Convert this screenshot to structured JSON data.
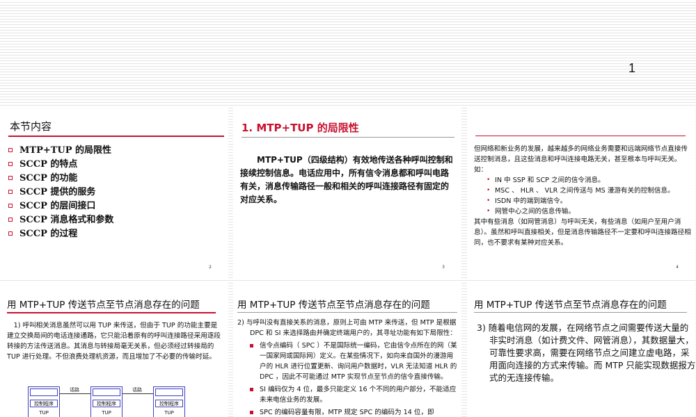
{
  "top_page_number": "1",
  "s2": {
    "title": "本节内容",
    "items": [
      "MTP+TUP 的局限性",
      "SCCP 的特点",
      "SCCP 的功能",
      "SCCP 提供的服务",
      "SCCP 的层间接口",
      "SCCP 消息格式和参数",
      "SCCP 的过程"
    ],
    "page": "2"
  },
  "s3": {
    "title": "1. MTP+TUP 的局限性",
    "body": "MTP+TUP（四级结构）有效地传送各种呼叫控制和接续控制信息。电话应用中，所有信令消息都和呼叫电路有关，消息传输路径一般和相关的呼叫连接路径有固定的对应关系。",
    "page": "3"
  },
  "s4": {
    "intro": "但网络和新业务的发展，越来越多的网络业务需要和远端网络节点直接传送控制消息，且这些消息和呼叫连接电路无关，甚至根本与呼叫无关。如：",
    "bullets": [
      "IN 中 SSP 和 SCP 之间的信令消息。",
      "MSC 、 HLR 、 VLR 之间传送与 MS 漫游有关的控制信息。",
      "ISDN 中的端到端信令。",
      "网管中心之间的信息传输。"
    ],
    "outro": "其中有些消息（如网管消息）与呼叫无关，有些消息（如用户至用户消息）。虽然和呼叫直接相关，但是消息传输路径不一定要和呼叫连接路径相同，也不要求有某种对应关系。",
    "page": "4"
  },
  "s5": {
    "title": "用 MTP+TUP 传送节点至节点消息存在的问题",
    "body": "1) 呼叫相关消息虽然可以用 TUP 来传送，但由于 TUP 的功能主要是建立交换局间的电话连接通路，它只能沿着原有的呼叫连接路径采用逐段转接的方法传送消息。其消息与转接局毫无关系，但必须经过转接局的 TUP 进行处理。不但浪费处理机资源，而且增加了不必要的传输时延。",
    "diagram": {
      "link_label": "话路",
      "node_top": "控制程序",
      "node_mid": "TUP"
    }
  },
  "s6": {
    "title": "用 MTP+TUP 传送节点至节点消息存在的问题",
    "intro": "2) 与呼叫没有直接关系的消息，原则上可由 MTP 来传送，但 MTP 是根据 DPC 和 SI 来选择路由并确定终端用户的，其寻址功能有如下局限性：",
    "bullets": [
      "信令点编码（ SPC ）不是国际统一编码，它由信令点所在的网（某一国家网或国际网）定义。在某些情况下，如向来自国外的漫游用户的 HLR 进行位置更新、询问用户数据时，VLR 无法知道 HLR 的 DPC ，因此不可能通过 MTP 实现节点至节点的信令直接传输。",
      "SI 编码仅为 4 位，最多只能定义 16 个不同的用户部分，不能适应未来电信业务的发展。"
    ],
    "cut_text": "SPC 的编码容量有限，MTP 规定 SPC 的编码为 14 位，即"
  },
  "s7": {
    "title": "用 MTP+TUP 传送节点至节点消息存在的问题",
    "body": "3) 随着电信网的发展，在网络节点之间需要传送大量的非实时消息（如计费文件、网管消息），其数据量大，可靠性要求高，需要在网络节点之间建立虚电路，采用面向连接的方式来传输。而 MTP 只能实现数据报方式的无连接传输。"
  }
}
